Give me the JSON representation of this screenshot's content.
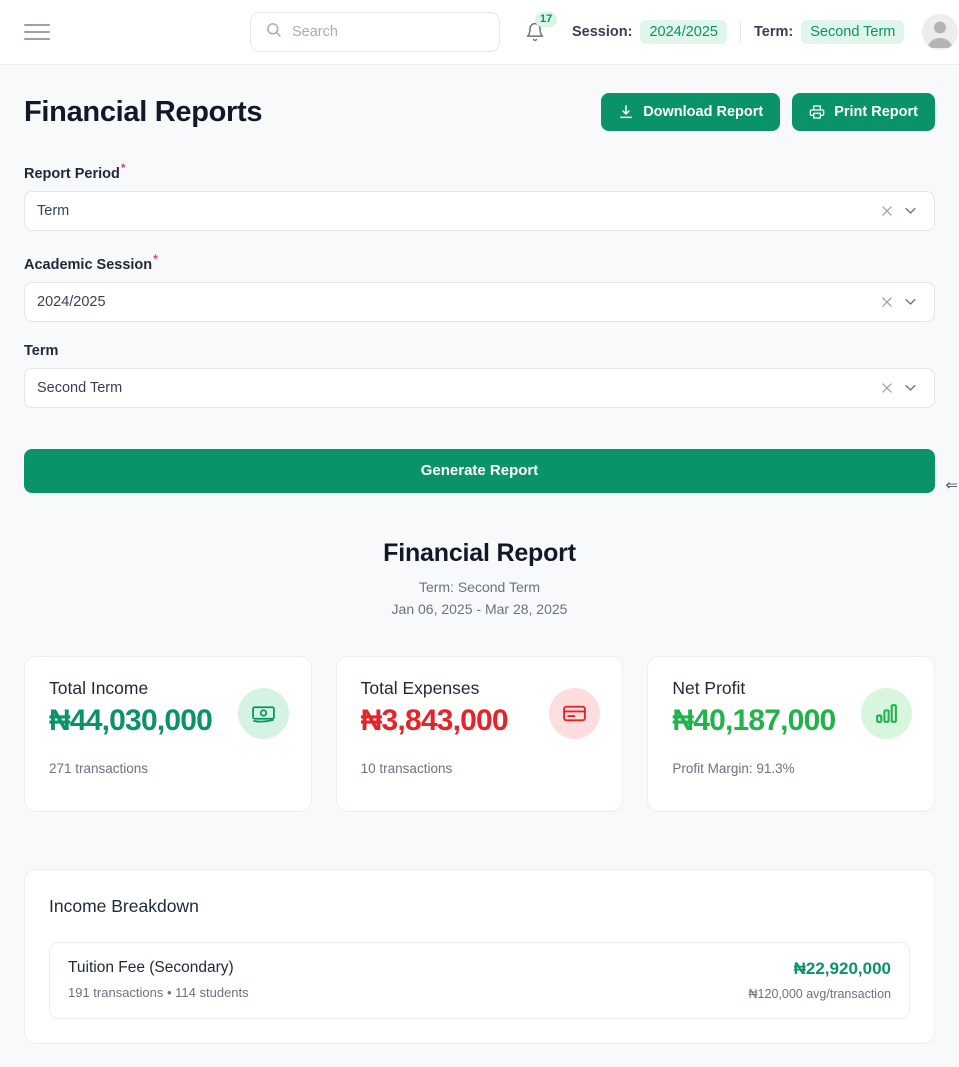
{
  "topbar": {
    "menu_icon": "hamburger-menu-icon",
    "search": {
      "placeholder": "Search",
      "value": "",
      "icon": "search-icon"
    },
    "notifications": {
      "icon": "bell-icon",
      "count": "17"
    },
    "session": {
      "label": "Session:",
      "value": "2024/2025"
    },
    "term": {
      "label": "Term:",
      "value": "Second Term"
    },
    "avatar_icon": "user-avatar-icon"
  },
  "header": {
    "title": "Financial Reports",
    "download_label": "Download Report",
    "download_icon": "download-icon",
    "print_label": "Print Report",
    "print_icon": "printer-icon"
  },
  "form": {
    "fields": [
      {
        "label": "Report Period",
        "required": true,
        "value": "Term",
        "clear_icon": "close-x-icon",
        "chevron_icon": "chevron-down-icon"
      },
      {
        "label": "Academic Session",
        "required": true,
        "value": "2024/2025",
        "clear_icon": "close-x-icon",
        "chevron_icon": "chevron-down-icon"
      },
      {
        "label": "Term",
        "required": false,
        "value": "Second Term",
        "clear_icon": "close-x-icon",
        "chevron_icon": "chevron-down-icon"
      }
    ],
    "generate_label": "Generate Report"
  },
  "resize_marker": "⇐",
  "report": {
    "title": "Financial Report",
    "subtitle_term": "Term: Second Term",
    "subtitle_range": "Jan 06, 2025 - Mar 28, 2025"
  },
  "summary_cards": [
    {
      "label": "Total Income",
      "value": "₦44,030,000",
      "value_color": "#0a9268",
      "footer": "271 transactions",
      "icon": "banknote-icon",
      "icon_bg": "#d4f3e2",
      "icon_color": "#0a9268"
    },
    {
      "label": "Total Expenses",
      "value": "₦3,843,000",
      "value_color": "#e5232b",
      "footer": "10 transactions",
      "icon": "credit-card-icon",
      "icon_bg": "#fcdedf",
      "icon_color": "#e5232b"
    },
    {
      "label": "Net Profit",
      "value": "₦40,187,000",
      "value_color": "#22b24c",
      "footer": "Profit Margin: 91.3%",
      "icon": "bar-chart-icon",
      "icon_bg": "#d8f5de",
      "icon_color": "#22b24c"
    }
  ],
  "income_breakdown": {
    "title": "Income Breakdown",
    "rows": [
      {
        "name": "Tuition Fee (Secondary)",
        "meta": "191 transactions • 114 students",
        "amount": "₦22,920,000",
        "average": "₦120,000 avg/transaction"
      }
    ]
  },
  "theme": {
    "primary": "#0a9268",
    "danger": "#e5232b",
    "success_bright": "#22b24c",
    "page_bg": "#f8f9fa"
  }
}
